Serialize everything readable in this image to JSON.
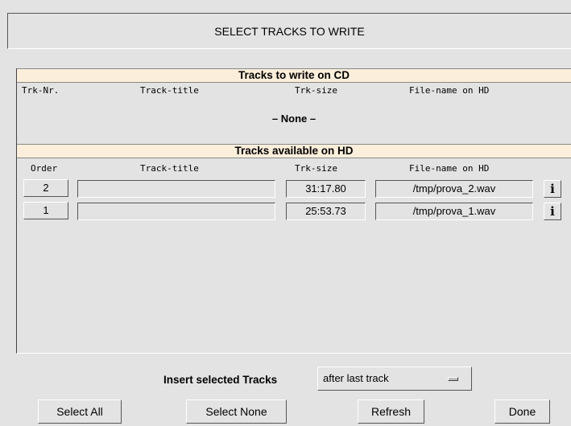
{
  "window": {
    "title": "SELECT TRACKS TO WRITE"
  },
  "write_section": {
    "header": "Tracks to write on CD",
    "columns": [
      "Trk-Nr.",
      "Track-title",
      "Trk-size",
      "File-name on HD"
    ],
    "empty_text": "– None –"
  },
  "available_section": {
    "header": "Tracks available on HD",
    "columns": [
      "Order",
      "Track-title",
      "Trk-size",
      "File-name on HD"
    ],
    "tracks": [
      {
        "order": "2",
        "title": "",
        "size": "31:17.80",
        "file": "/tmp/prova_2.wav",
        "info_icon": "i"
      },
      {
        "order": "1",
        "title": "",
        "size": "25:53.73",
        "file": "/tmp/prova_1.wav",
        "info_icon": "i"
      }
    ]
  },
  "insert": {
    "label": "Insert selected Tracks",
    "selected": "after last track"
  },
  "buttons": {
    "select_all": "Select All",
    "select_none": "Select None",
    "refresh": "Refresh",
    "done": "Done"
  }
}
